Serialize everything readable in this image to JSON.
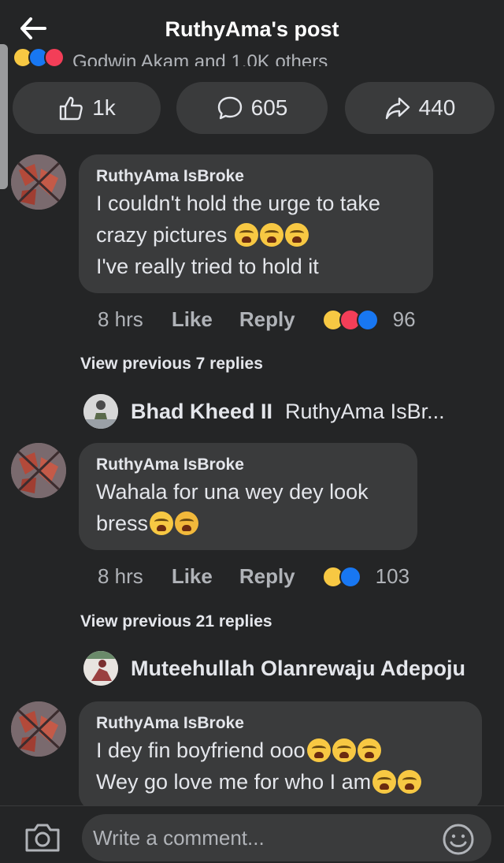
{
  "header": {
    "title": "RuthyAma's post"
  },
  "reactors": {
    "text": "Godwin Akam and 1.0K others"
  },
  "actions": {
    "like_count": "1k",
    "comment_count": "605",
    "share_count": "440"
  },
  "comments": [
    {
      "author": "RuthyAma IsBroke",
      "lines": [
        "I couldn't hold the urge to take",
        "crazy pictures",
        "I've really tried to hold it"
      ],
      "time": "8 hrs",
      "like_label": "Like",
      "reply_label": "Reply",
      "reaction_count": "96"
    },
    {
      "author": "RuthyAma IsBroke",
      "lines": [
        "Wahala for una wey dey look",
        "bress"
      ],
      "time": "8 hrs",
      "like_label": "Like",
      "reply_label": "Reply",
      "reaction_count": "103"
    },
    {
      "author": "RuthyAma IsBroke",
      "lines": [
        "I dey fin boyfriend ooo",
        "Wey go love me for who I am"
      ]
    }
  ],
  "view_previous": [
    "View previous 7 replies",
    "View previous 21 replies"
  ],
  "reply_rows": [
    {
      "name": "Bhad Kheed II",
      "mention": "RuthyAma IsBr..."
    },
    {
      "name": "Muteehullah Olanrewaju Adepoju",
      "mention": ""
    }
  ],
  "composer": {
    "placeholder": "Write a comment..."
  },
  "colors": {
    "background": "#242526",
    "bubble": "#3a3b3c",
    "like_blue": "#1877f2",
    "love_red": "#f33e58",
    "haha_yellow": "#f7c843"
  },
  "icons": [
    "back-arrow-icon",
    "thumbs-up-icon",
    "comment-icon",
    "share-icon",
    "camera-icon",
    "smiley-icon"
  ]
}
